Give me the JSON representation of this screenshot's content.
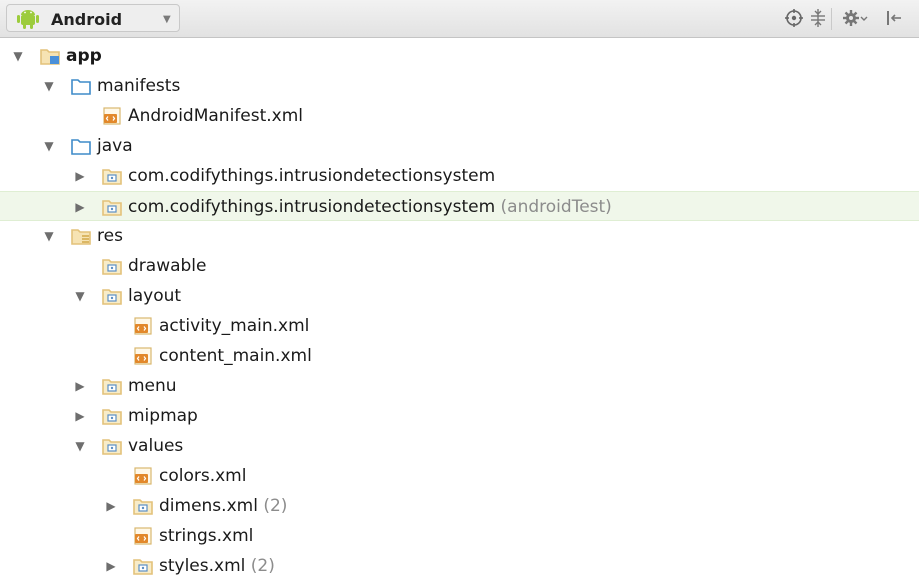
{
  "toolbar": {
    "view_mode": "Android",
    "icons": [
      "android-icon",
      "chevron-down-icon",
      "locate-icon",
      "collapse-all-icon",
      "gear-icon",
      "hide-panel-icon"
    ]
  },
  "tree": [
    {
      "label": "app",
      "suffix": "",
      "icon": "module-folder-icon",
      "state": "expanded",
      "depth": 0,
      "bold": true
    },
    {
      "label": "manifests",
      "suffix": "",
      "icon": "folder-icon",
      "state": "expanded",
      "depth": 1
    },
    {
      "label": "AndroidManifest.xml",
      "suffix": "",
      "icon": "xml-file-icon",
      "state": "leaf",
      "depth": 2
    },
    {
      "label": "java",
      "suffix": "",
      "icon": "folder-icon",
      "state": "expanded",
      "depth": 1
    },
    {
      "label": "com.codifythings.intrusiondetectionsystem",
      "suffix": "",
      "icon": "package-icon",
      "state": "collapsed",
      "depth": 2
    },
    {
      "label": "com.codifythings.intrusiondetectionsystem",
      "suffix": "(androidTest)",
      "icon": "package-icon",
      "state": "collapsed",
      "depth": 2,
      "highlight": true
    },
    {
      "label": "res",
      "suffix": "",
      "icon": "resource-folder-icon",
      "state": "expanded",
      "depth": 1
    },
    {
      "label": "drawable",
      "suffix": "",
      "icon": "package-icon",
      "state": "leaf",
      "depth": 2
    },
    {
      "label": "layout",
      "suffix": "",
      "icon": "package-icon",
      "state": "expanded",
      "depth": 2
    },
    {
      "label": "activity_main.xml",
      "suffix": "",
      "icon": "xml-file-icon",
      "state": "leaf",
      "depth": 3
    },
    {
      "label": "content_main.xml",
      "suffix": "",
      "icon": "xml-file-icon",
      "state": "leaf",
      "depth": 3
    },
    {
      "label": "menu",
      "suffix": "",
      "icon": "package-icon",
      "state": "collapsed",
      "depth": 2
    },
    {
      "label": "mipmap",
      "suffix": "",
      "icon": "package-icon",
      "state": "collapsed",
      "depth": 2
    },
    {
      "label": "values",
      "suffix": "",
      "icon": "package-icon",
      "state": "expanded",
      "depth": 2
    },
    {
      "label": "colors.xml",
      "suffix": "",
      "icon": "xml-file-icon",
      "state": "leaf",
      "depth": 3
    },
    {
      "label": "dimens.xml",
      "suffix": "(2)",
      "icon": "package-icon",
      "state": "collapsed",
      "depth": 3
    },
    {
      "label": "strings.xml",
      "suffix": "",
      "icon": "xml-file-icon",
      "state": "leaf",
      "depth": 3
    },
    {
      "label": "styles.xml",
      "suffix": "(2)",
      "icon": "package-icon",
      "state": "collapsed",
      "depth": 3
    }
  ],
  "colors": {
    "folder_blue": "#3f8bc9",
    "folder_tan": "#e3c27a",
    "xml_orange": "#e2882b",
    "selection_green": "#f0f7ea"
  }
}
